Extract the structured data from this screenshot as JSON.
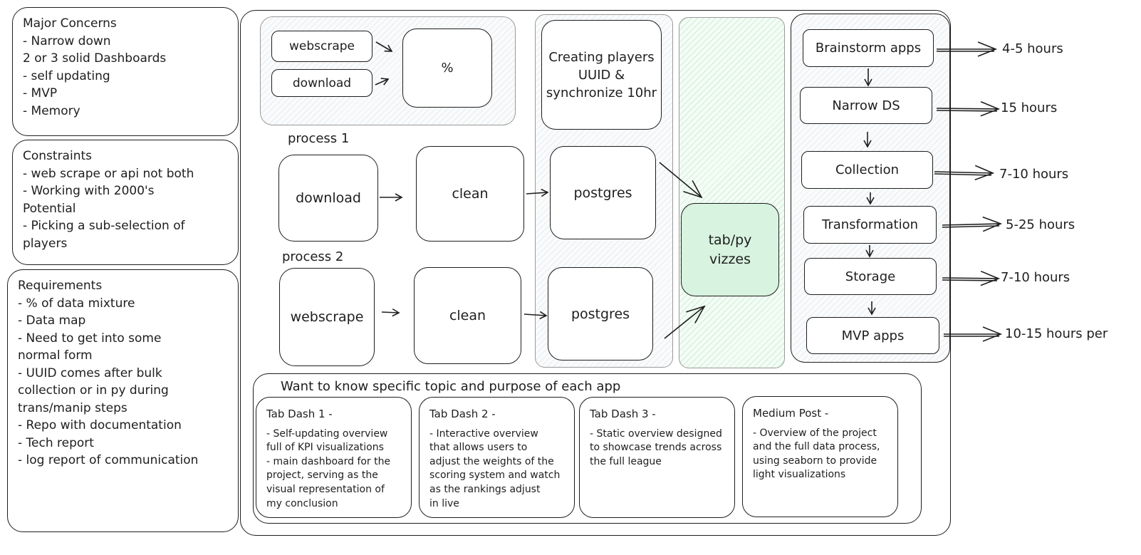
{
  "notes": {
    "major": "Major Concerns\n- Narrow down\n2 or 3 solid Dashboards\n- self updating\n- MVP\n- Memory",
    "constraints": "Constraints\n- web scrape or api not both\n- Working with 2000's\nPotential\n- Picking a sub-selection of\nplayers",
    "requirements": "Requirements\n- % of data mixture\n- Data map\n- Need to get into some\nnormal form\n- UUID comes after bulk\ncollection or in py during\ntrans/manip steps\n- Repo with documentation\n- Tech report\n- log report of communication"
  },
  "top": {
    "webscrape": "webscrape",
    "download": "download",
    "percent": "%"
  },
  "uuid_box": "Creating players\nUUID &\nsynchronize 10hr",
  "process1": {
    "label": "process 1",
    "download": "download",
    "clean": "clean",
    "postgres": "postgres"
  },
  "process2": {
    "label": "process 2",
    "webscrape": "webscrape",
    "clean": "clean",
    "postgres": "postgres"
  },
  "viz": "tab/py\nvizzes",
  "steps": [
    {
      "label": "Brainstorm apps",
      "hours": "4-5 hours"
    },
    {
      "label": "Narrow DS",
      "hours": "15 hours"
    },
    {
      "label": "Collection",
      "hours": "7-10 hours"
    },
    {
      "label": "Transformation",
      "hours": "5-25 hours"
    },
    {
      "label": "Storage",
      "hours": "7-10 hours"
    },
    {
      "label": "MVP apps",
      "hours": "10-15 hours per"
    }
  ],
  "apps": {
    "heading": "Want to know specific topic and purpose of each app",
    "cards": [
      {
        "title": "Tab Dash 1 -",
        "body": "- Self-updating overview\nfull of KPI visualizations\n- main dashboard for the\nproject, serving as the\nvisual representation of\nmy conclusion"
      },
      {
        "title": "Tab Dash 2 -",
        "body": "- Interactive overview\nthat allows users to\nadjust the weights of the\nscoring system and watch\nas the rankings adjust\nin live"
      },
      {
        "title": "Tab Dash 3 -",
        "body": "- Static overview designed\nto showcase trends across\nthe full league"
      },
      {
        "title": "Medium Post -",
        "body": "- Overview of the project\nand the full data process,\nusing seaborn to provide\nlight visualizations"
      }
    ]
  }
}
